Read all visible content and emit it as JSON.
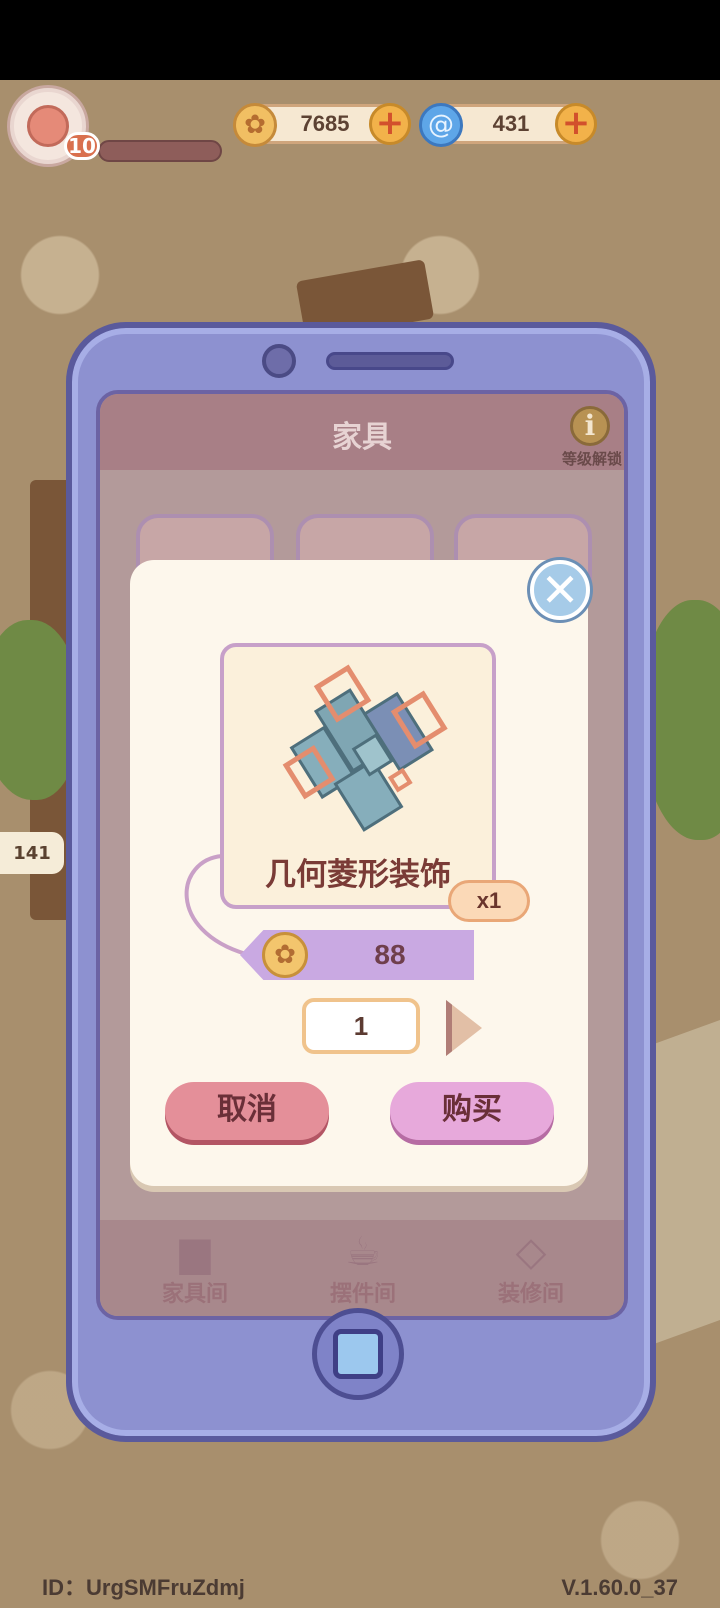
{
  "hud": {
    "level": "10",
    "coins": "7685",
    "gems": "431"
  },
  "screen": {
    "title": "家具",
    "info_label": "等级解锁",
    "nav": [
      {
        "label": "家具间",
        "icon": "armchair-icon"
      },
      {
        "label": "摆件间",
        "icon": "teacup-icon"
      },
      {
        "label": "装修间",
        "icon": "floor-tile-icon"
      }
    ]
  },
  "scene": {
    "bubble_count": "141"
  },
  "dialog": {
    "item_name": "几何菱形装饰",
    "quantity_badge": "x1",
    "price": "88",
    "quantity": "1",
    "cancel_label": "取消",
    "buy_label": "购买"
  },
  "footer": {
    "id_text": "ID：UrgSMFruZdmj",
    "version": "V.1.60.0_37"
  },
  "colors": {
    "phone": "#8d91d0",
    "dialog": "#fdf7ec",
    "cancel": "#e48f99",
    "buy": "#e7a9db",
    "price_tag": "#c9a9e2"
  }
}
